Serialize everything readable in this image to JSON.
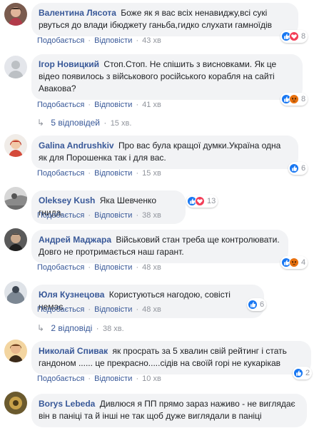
{
  "colors": {
    "link": "#385898",
    "meta": "#90949c",
    "bubble": "#f2f3f5",
    "like": "#1877f2",
    "love": "#f33e58",
    "angry": "#e9710f"
  },
  "labels": {
    "reply": "Подобається",
    "answer": "Відповісти",
    "dot": "·"
  },
  "comments": [
    {
      "author": "Валентина Лясота",
      "text": "Боже як я вас всіх ненавиджу,всі сукі рвуться до влади ібюджету ганьба,гидко слухати гамноїдів",
      "time": "43 хв",
      "reactions": [
        "like-icon",
        "love-icon"
      ],
      "count": "8"
    },
    {
      "author": "Ігор Новицкий",
      "text": "Стоп.Стоп. Не спішить з висновками. Як це відео появилось з військового російського корабля на сайті Авакова?",
      "time": "41 хв",
      "reactions": [
        "like-icon",
        "angry-icon"
      ],
      "count": "8",
      "replies": {
        "label": "5 відповідей",
        "time": "15 хв."
      }
    },
    {
      "author": "Galina Andrushkiv",
      "text": "Про вас була кращої думки.Україна одна як для Порошенка так і для вас.",
      "time": "15 хв",
      "reactions": [
        "like-icon"
      ],
      "count": "6"
    },
    {
      "author": "Oleksey Kush",
      "text": "Яка Шевченко гнида.",
      "time": "38 хв",
      "reactions": [
        "like-icon",
        "love-icon"
      ],
      "count": "13"
    },
    {
      "author": "Андрей Маджара",
      "text": "Військовий стан треба ще контролювати. Довго не протримається наш гарант.",
      "time": "48 хв",
      "reactions": [
        "like-icon",
        "angry-icon"
      ],
      "count": "4"
    },
    {
      "author": "Юля Кузнецова",
      "text": "Користуються нагодою, совісті немає",
      "time": "48 хв",
      "reactions": [
        "like-icon"
      ],
      "count": "6",
      "replies": {
        "label": "2 відповіді",
        "time": "38 хв."
      }
    },
    {
      "author": "Николай Спивак",
      "text": "як просрать за 5 хвалин свій рейтинг і стать гандоном ...... це прекрасно.....сідів на своїй горі не кукарікав",
      "time": "10 хв",
      "reactions": [
        "like-icon"
      ],
      "count": "2"
    },
    {
      "author": "Borys Lebeda",
      "text": "Дивлюся я ПП прямо зараз наживо - не виглядає він в паніці та й інші не так щоб дуже виглядали в паніці",
      "time": "",
      "reactions": [],
      "count": ""
    }
  ]
}
